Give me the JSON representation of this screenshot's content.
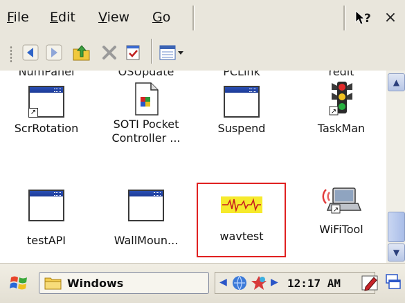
{
  "menubar": {
    "items": [
      "File",
      "Edit",
      "View",
      "Go"
    ],
    "help_label": "?",
    "close_label": "×"
  },
  "toolbar": {
    "buttons": [
      "back-icon",
      "forward-icon",
      "up-folder-icon",
      "delete-icon",
      "properties-icon",
      "views-icon"
    ]
  },
  "content": {
    "top_partial_labels": [
      "NumPanel",
      "OSUpdate",
      "PCLink",
      "redit"
    ],
    "items": [
      {
        "label": "ScrRotation",
        "icon": "shortcut-window-icon"
      },
      {
        "label": "SOTI Pocket",
        "label2": "Controller ...",
        "icon": "soti-document-icon"
      },
      {
        "label": "Suspend",
        "icon": "window-icon"
      },
      {
        "label": "TaskMan",
        "icon": "traffic-light-icon"
      },
      {
        "label": "testAPI",
        "icon": "window-icon"
      },
      {
        "label": "WallMoun...",
        "icon": "window-icon"
      },
      {
        "label": "wavtest",
        "icon": "waveform-icon"
      },
      {
        "label": "WiFiTool",
        "icon": "wifi-laptop-icon"
      }
    ],
    "highlighted_item": "wavtest"
  },
  "taskbar": {
    "window_label": "Windows",
    "clock": "12:17 AM"
  },
  "colors": {
    "chrome_bg": "#e9e6dc",
    "highlight_border": "#e02020",
    "title_blue": "#1c3a96"
  }
}
